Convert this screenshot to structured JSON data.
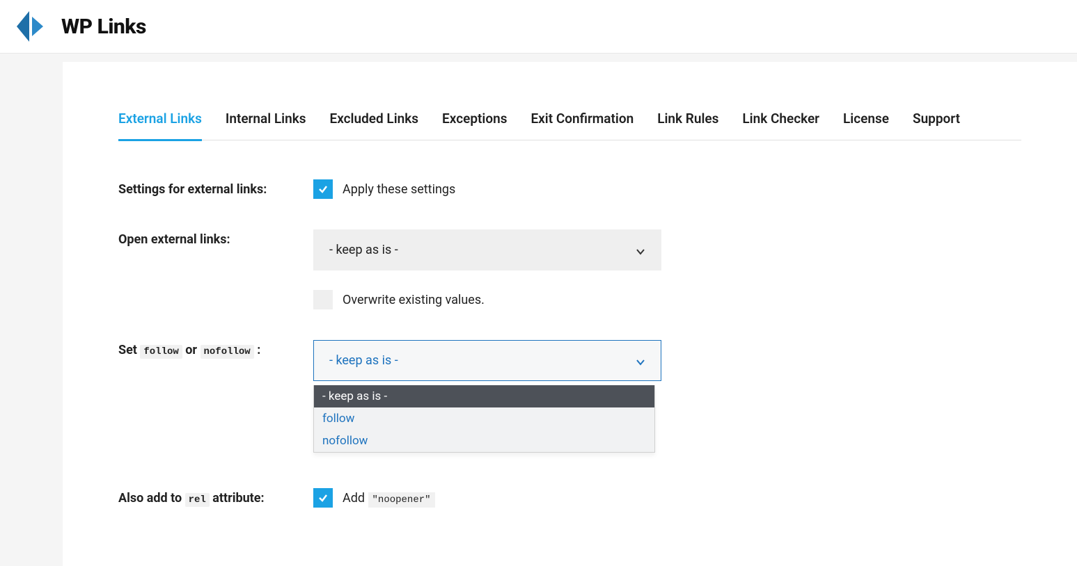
{
  "header": {
    "logo_text": "WP Links"
  },
  "tabs": [
    "External Links",
    "Internal Links",
    "Excluded Links",
    "Exceptions",
    "Exit Confirmation",
    "Link Rules",
    "Link Checker",
    "License",
    "Support"
  ],
  "settings": {
    "apply_label": "Settings for external links:",
    "apply_check_label": "Apply these settings",
    "open_label": "Open external links:",
    "open_select_value": "- keep as is -",
    "overwrite_label": "Overwrite existing values.",
    "follow_label_pre": "Set ",
    "follow_code1": "follow",
    "follow_label_or": " or ",
    "follow_code2": "nofollow",
    "follow_label_post": " :",
    "follow_select_value": "- keep as is -",
    "follow_options": [
      "- keep as is -",
      "follow",
      "nofollow"
    ],
    "rel_label_pre": "Also add to ",
    "rel_code": "rel",
    "rel_label_post": " attribute:",
    "rel_add_label": "Add ",
    "rel_add_value": "\"noopener\""
  }
}
